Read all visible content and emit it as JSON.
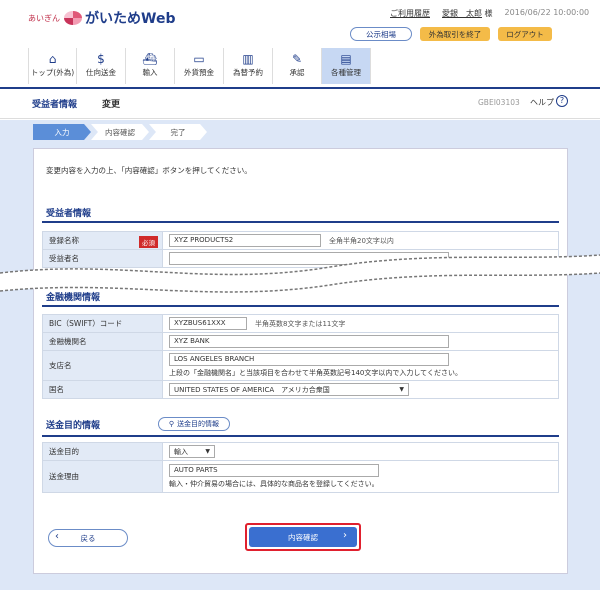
{
  "brand": {
    "prefix": "あいぎん",
    "name": "がいためWeb"
  },
  "top": {
    "history": "ご利用履歴",
    "user_name": "愛銀　太郎",
    "user_suffix": "様",
    "datetime": "2016/06/22 10:00:00"
  },
  "pills": {
    "rates": "公示相場",
    "end_fx": "外為取引を終了",
    "logout": "ログアウト"
  },
  "nav": [
    {
      "label": "トップ(外為)",
      "icon": "home-icon"
    },
    {
      "label": "仕向送金",
      "icon": "coins-icon"
    },
    {
      "label": "輸入",
      "icon": "ship-icon"
    },
    {
      "label": "外貨預金",
      "icon": "wallet-icon"
    },
    {
      "label": "為替予約",
      "icon": "chart-icon"
    },
    {
      "label": "承認",
      "icon": "approve-icon"
    },
    {
      "label": "各種管理",
      "icon": "manage-icon"
    }
  ],
  "title": {
    "main": "受益者情報",
    "sub": "変更",
    "screen_id": "GBEI03103",
    "help": "ヘルプ"
  },
  "steps": [
    "入力",
    "内容確認",
    "完了"
  ],
  "instruction": "変更内容を入力の上、「内容確認」ボタンを押してください。",
  "beneficiary": {
    "section": "受益者情報",
    "reg_label": "登録名称",
    "required": "必須",
    "reg_value": "XYZ PRODUCTS2",
    "reg_hint": "全角半角20文字以内",
    "name_label": "受益者名"
  },
  "bank": {
    "section": "金融機関情報",
    "bic_label": "BIC（SWIFT）コード",
    "bic_value": "XYZBUS61XXX",
    "bic_hint": "半角英数8文字または11文字",
    "name_label": "金融機関名",
    "name_value": "XYZ BANK",
    "branch_label": "支店名",
    "branch_value": "LOS ANGELES BRANCH",
    "branch_note": "上段の「金融機関名」と当該項目を合わせて半角英数記号140文字以内で入力してください。",
    "country_label": "国名",
    "country_value": "UNITED STATES OF AMERICA　アメリカ合衆国"
  },
  "purpose": {
    "section": "送金目的情報",
    "btn": "送金目的情報",
    "purpose_label": "送金目的",
    "purpose_value": "輸入",
    "reason_label": "送金理由",
    "reason_value": "AUTO PARTS",
    "reason_note": "輸入・仲介貿易の場合には、具体的な商品名を登録してください。"
  },
  "buttons": {
    "back": "戻る",
    "confirm": "内容確認"
  }
}
